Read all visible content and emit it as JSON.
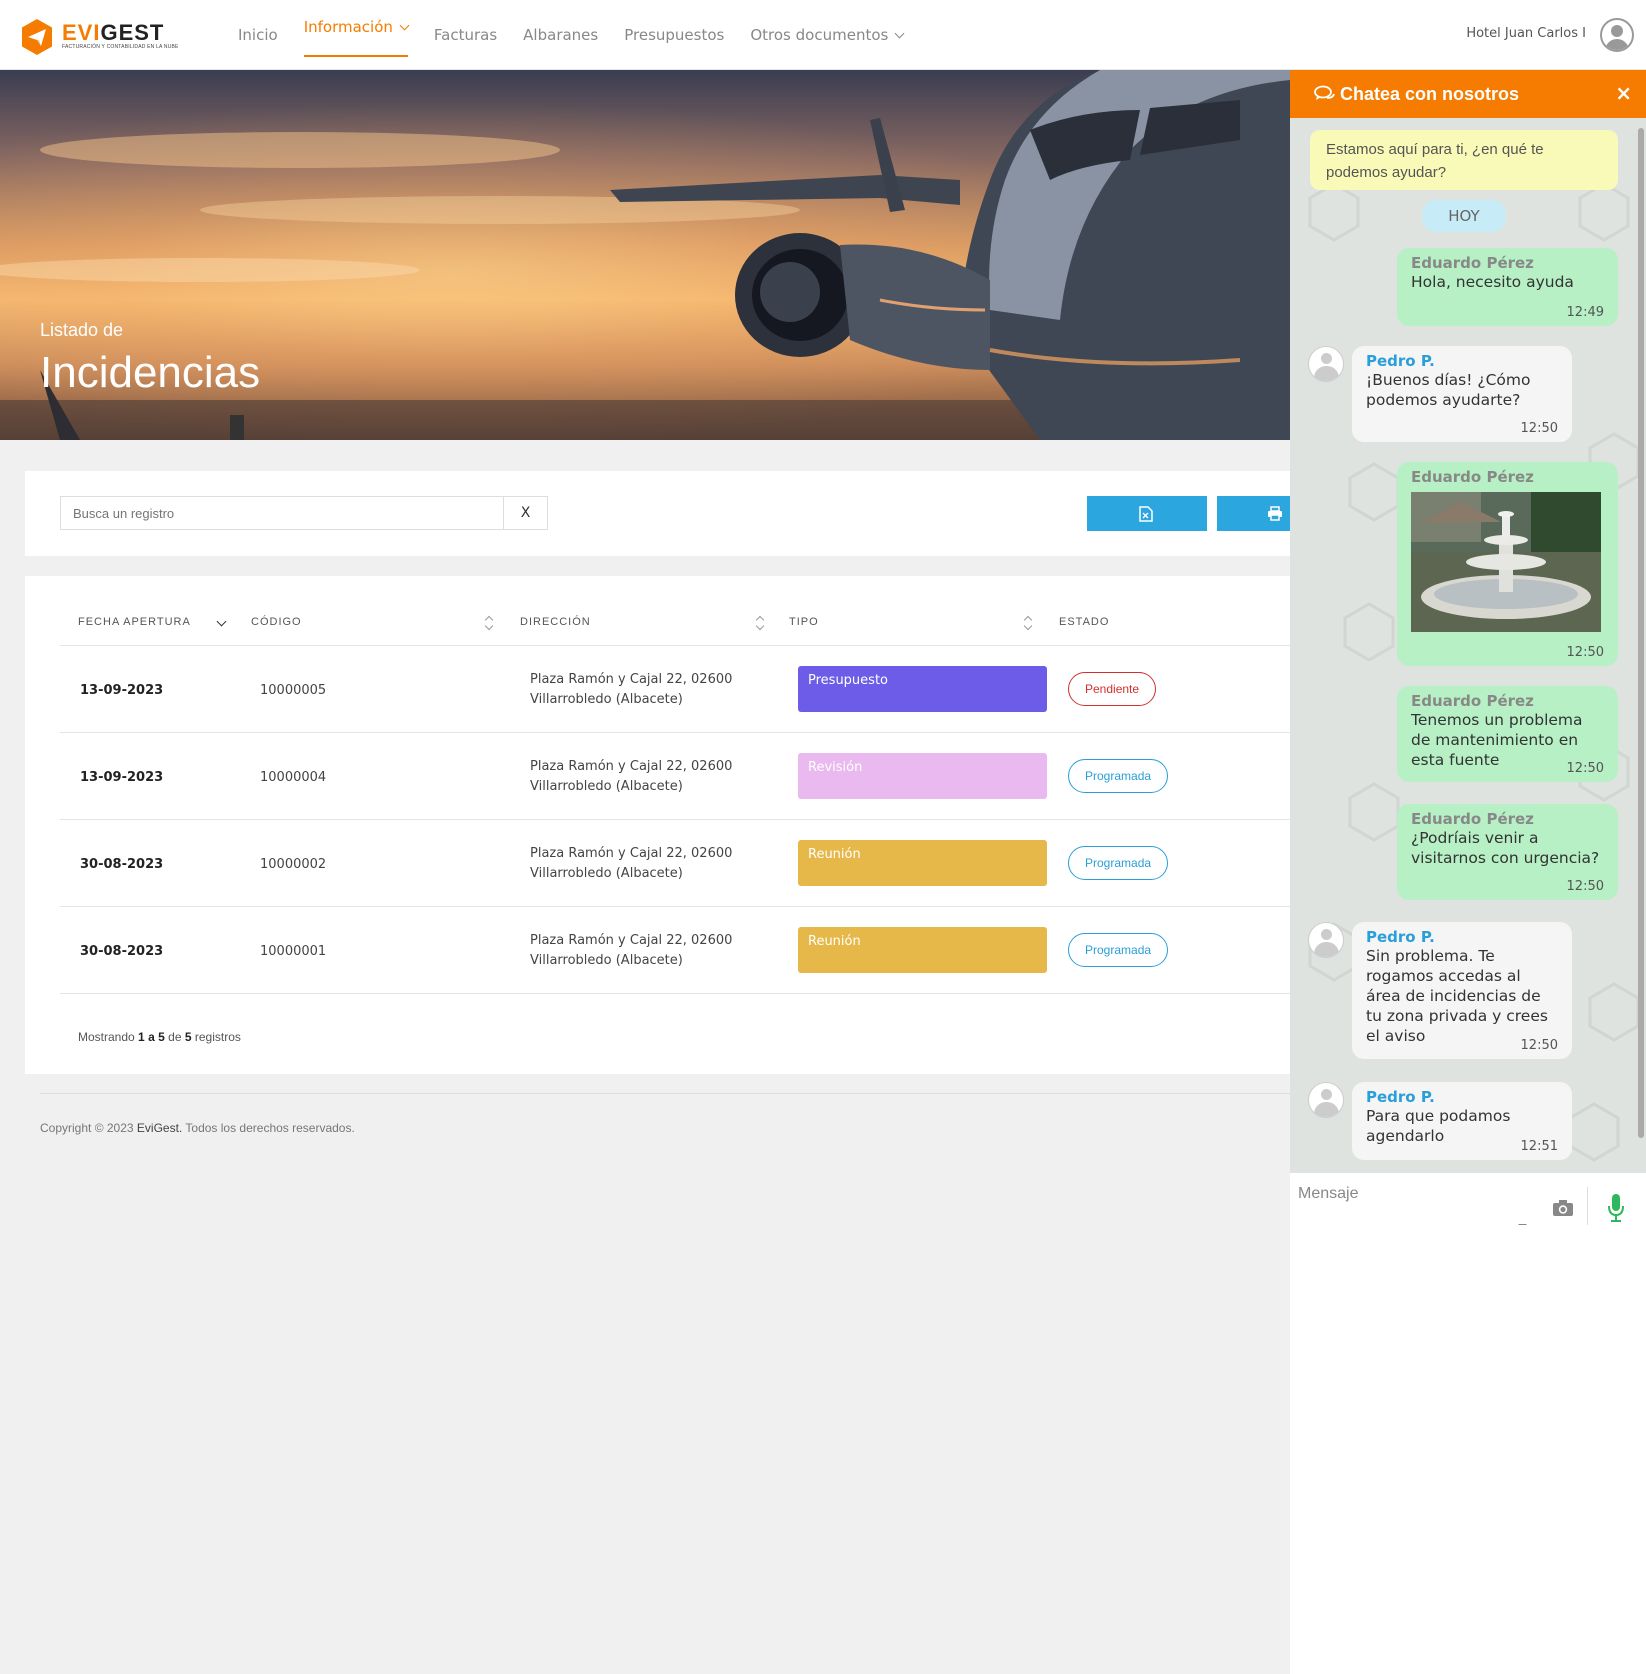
{
  "brand": {
    "name_part1": "EVI",
    "name_part2": "GEST",
    "tagline": "FACTURACIÓN Y CONTABILIDAD EN LA NUBE",
    "accent": "#f57c00"
  },
  "nav": {
    "items": [
      {
        "label": "Inicio"
      },
      {
        "label": "Información",
        "active": true,
        "dropdown": true
      },
      {
        "label": "Facturas"
      },
      {
        "label": "Albaranes"
      },
      {
        "label": "Presupuestos"
      },
      {
        "label": "Otros documentos",
        "dropdown": true
      }
    ],
    "user": "Hotel Juan Carlos I"
  },
  "hero": {
    "subtitle": "Listado de",
    "title": "Incidencias"
  },
  "search": {
    "placeholder": "Busca un registro",
    "clear_label": "X",
    "icons": [
      "excel-file-icon",
      "print-icon"
    ]
  },
  "table": {
    "headers": [
      "FECHA APERTURA",
      "CÓDIGO",
      "DIRECCIÓN",
      "TIPO",
      "ESTADO"
    ],
    "rows": [
      {
        "fecha": "13-09-2023",
        "codigo": "10000005",
        "direccion": "Plaza Ramón y Cajal 22, 02600 Villarrobledo (Albacete)",
        "tipo": "Presupuesto",
        "tipo_color": "#6c5ce7",
        "estado": "Pendiente",
        "estado_color": "#d32f2f"
      },
      {
        "fecha": "13-09-2023",
        "codigo": "10000004",
        "direccion": "Plaza Ramón y Cajal 22, 02600 Villarrobledo (Albacete)",
        "tipo": "Revisión",
        "tipo_color": "#e9b9f0",
        "estado": "Programada",
        "estado_color": "#2b9ed9"
      },
      {
        "fecha": "30-08-2023",
        "codigo": "10000002",
        "direccion": "Plaza Ramón y Cajal 22, 02600 Villarrobledo (Albacete)",
        "tipo": "Reunión",
        "tipo_color": "#e6b84a",
        "estado": "Programada",
        "estado_color": "#2b9ed9"
      },
      {
        "fecha": "30-08-2023",
        "codigo": "10000001",
        "direccion": "Plaza Ramón y Cajal 22, 02600 Villarrobledo (Albacete)",
        "tipo": "Reunión",
        "tipo_color": "#e6b84a",
        "estado": "Programada",
        "estado_color": "#2b9ed9"
      }
    ],
    "info_prefix": "Mostrando",
    "info_from": "1",
    "info_a": "a",
    "info_to": "5",
    "info_de": "de",
    "info_total": "5",
    "info_suffix": "registros"
  },
  "footer": {
    "copyright": "Copyright © 2023",
    "brand": "EviGest.",
    "rights": "Todos los derechos reservados."
  },
  "chat": {
    "title": "Chatea con nosotros",
    "close": "×",
    "banner": "Estamos aquí para ti, ¿en qué te podemos ayudar?",
    "day": "HOY",
    "messages": [
      {
        "who": "Eduardo Pérez",
        "text": "Hola, necesito ayuda",
        "time": "12:49"
      },
      {
        "who": "Pedro P.",
        "text": "¡Buenos días! ¿Cómo podemos ayudarte?",
        "time": "12:50"
      },
      {
        "who": "Eduardo Pérez",
        "text": "",
        "time": "12:50",
        "image": "fountain-photo"
      },
      {
        "who": "Eduardo Pérez",
        "text": "Tenemos un problema de mantenimiento en esta fuente",
        "time": "12:50"
      },
      {
        "who": "Eduardo Pérez",
        "text": "¿Podríais venir a visitarnos con urgencia?",
        "time": "12:50"
      },
      {
        "who": "Pedro P.",
        "text": "Sin problema. Te rogamos accedas al área de incidencias de tu zona privada y crees el aviso",
        "time": "12:50"
      },
      {
        "who": "Pedro P.",
        "text": "Para que podamos agendarlo",
        "time": "12:51"
      }
    ],
    "input_placeholder": "Mensaje"
  }
}
